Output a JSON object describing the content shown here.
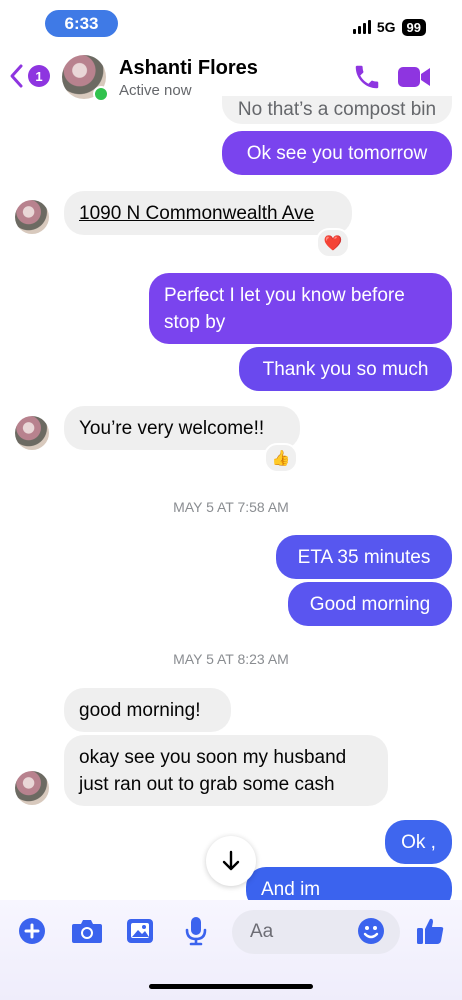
{
  "status_bar": {
    "time": "6:33",
    "network": "5G",
    "battery": "99"
  },
  "header": {
    "back_count": "1",
    "contact_name": "Ashanti Flores",
    "status": "Active now",
    "accent_color": "#8e35e0"
  },
  "messages": [
    {
      "text": "No that’s a compost bin"
    },
    {
      "text": "Ok see you tomorrow"
    },
    {
      "text": "1090 N Commonwealth Ave",
      "reaction": "❤️"
    },
    {
      "text": "Perfect I let you know before stop by"
    },
    {
      "text": "Thank you so much"
    },
    {
      "text": "You’re very welcome!!",
      "reaction": "👍"
    },
    {
      "text": "ETA 35 minutes"
    },
    {
      "text": "Good morning"
    },
    {
      "text": "good morning!"
    },
    {
      "text": "okay see you soon my husband just ran out to grab some cash"
    },
    {
      "text": "Ok ,"
    },
    {
      "text": "And im"
    }
  ],
  "timestamps": [
    "MAY 5 AT 7:58 AM",
    "MAY 5 AT 8:23 AM"
  ],
  "composer": {
    "placeholder": "Aa"
  },
  "icons": [
    "back-chevron-icon",
    "phone-icon",
    "video-icon",
    "plus-icon",
    "camera-icon",
    "image-icon",
    "microphone-icon",
    "emoji-icon",
    "thumbs-up-icon",
    "arrow-down-icon"
  ]
}
